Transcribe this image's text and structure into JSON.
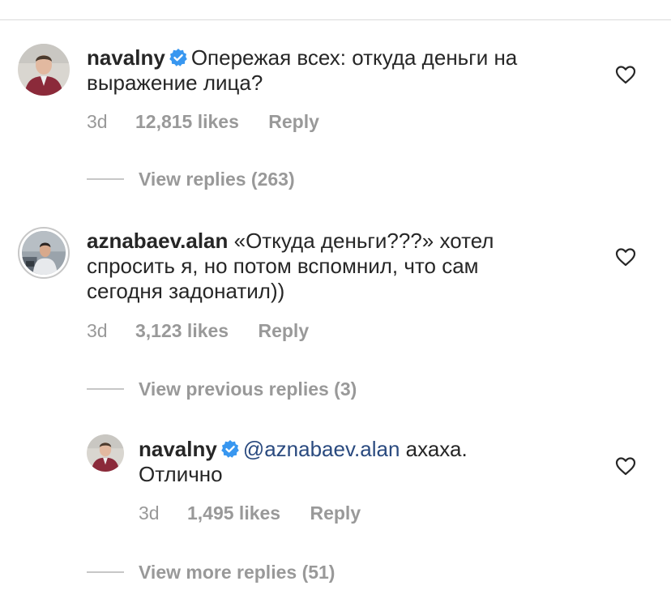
{
  "comments": [
    {
      "username": "navalny",
      "verified": true,
      "text": "Опережая всех: откуда деньги на выражение лица?",
      "time": "3d",
      "likes": "12,815 likes",
      "reply": "Reply",
      "view_replies": "View replies (263)"
    },
    {
      "username": "aznabaev.alan",
      "verified": false,
      "text": "«Откуда деньги???» хотел спросить я, но потом вспомнил, что сам сегодня задонатил))",
      "time": "3d",
      "likes": "3,123 likes",
      "reply": "Reply",
      "view_replies": "View previous replies (3)"
    }
  ],
  "reply": {
    "username": "navalny",
    "verified": true,
    "mention": "@aznabaev.alan",
    "text": " ахаха. Отлично",
    "time": "3d",
    "likes": "1,495 likes",
    "reply": "Reply",
    "view_replies": "View more replies (51)"
  },
  "colors": {
    "verified": "#3897f0",
    "mention": "#2a4a7f",
    "meta": "#999999"
  },
  "icons": [
    "verified-badge-icon",
    "heart-icon"
  ]
}
